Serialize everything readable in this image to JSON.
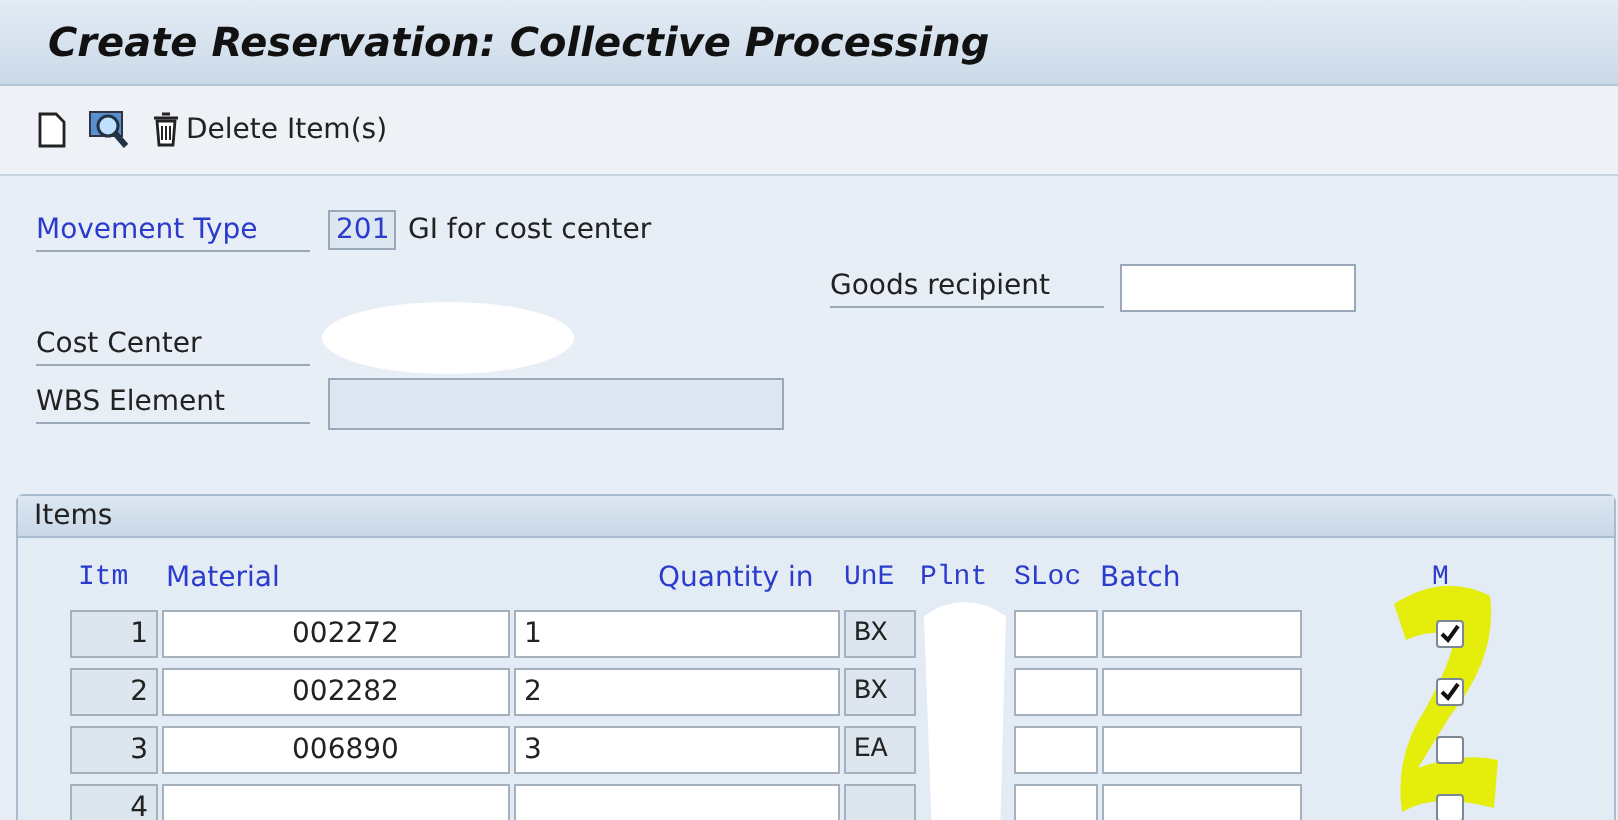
{
  "window": {
    "title": "Create Reservation: Collective Processing"
  },
  "toolbar": {
    "delete_label": "Delete Item(s)"
  },
  "header": {
    "movement_type": {
      "label": "Movement Type",
      "value": "201",
      "description": "GI for cost center"
    },
    "goods_recipient": {
      "label": "Goods recipient"
    },
    "cost_center": {
      "label": "Cost Center"
    },
    "wbs_element": {
      "label": "WBS Element"
    }
  },
  "items": {
    "title": "Items",
    "columns": [
      "Itm",
      "Material",
      "Quantity in",
      "UnE",
      "Plnt",
      "SLoc",
      "Batch",
      "M"
    ],
    "rows": [
      {
        "itm": "1",
        "material": "002272",
        "quantity": "1",
        "unit": "BX",
        "checked": true
      },
      {
        "itm": "2",
        "material": "002282",
        "quantity": "2",
        "unit": "BX",
        "checked": true
      },
      {
        "itm": "3",
        "material": "006890",
        "quantity": "3",
        "unit": "EA",
        "checked": false
      },
      {
        "itm": "4",
        "material": "",
        "quantity": "",
        "unit": "",
        "checked": false
      }
    ]
  }
}
